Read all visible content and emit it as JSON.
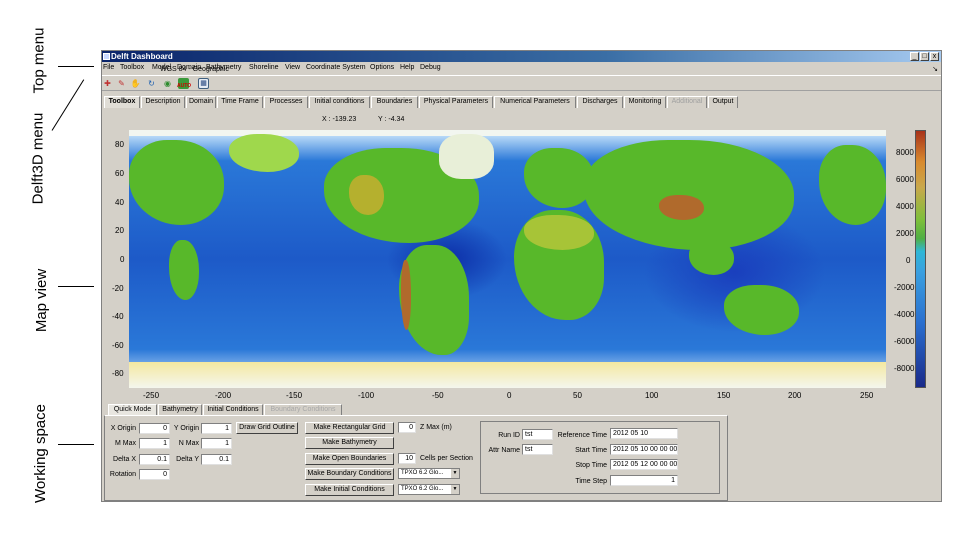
{
  "annotations": {
    "top_menu": "Top menu",
    "delft3d_menu": "Delft3D menu",
    "map_view": "Map view",
    "working_space": "Working space"
  },
  "window": {
    "title": "Delft Dashboard",
    "controls": [
      "_",
      "□",
      "x"
    ]
  },
  "menubar": [
    "File",
    "Toolbox",
    "Model",
    "Domain",
    "Bathymetry",
    "Shoreline",
    "View",
    "Coordinate System",
    "Options",
    "Help",
    "Debug"
  ],
  "toolbar": {
    "icons": [
      "zoom-in-icon",
      "zoom-out-icon",
      "pan-hand-icon",
      "refresh-icon",
      "globe-icon",
      "auto-icon",
      "chart-icon"
    ],
    "auto_label": "AUTO"
  },
  "tabs": [
    {
      "label": "Toolbox",
      "active": true
    },
    {
      "label": "Description"
    },
    {
      "label": "Domain"
    },
    {
      "label": "Time Frame"
    },
    {
      "label": "Processes"
    },
    {
      "label": "Initial conditions"
    },
    {
      "label": "Boundaries"
    },
    {
      "label": "Physical Parameters"
    },
    {
      "label": "Numerical Parameters"
    },
    {
      "label": "Discharges"
    },
    {
      "label": "Monitoring"
    },
    {
      "label": "Additional",
      "disabled": true
    },
    {
      "label": "Output"
    }
  ],
  "map": {
    "coord_system": "WGS 84 - Geographic",
    "x_readout": "X : -139.23",
    "y_readout": "Y : -4.34",
    "y_ticks": [
      "80",
      "60",
      "40",
      "20",
      "0",
      "-20",
      "-40",
      "-60",
      "-80"
    ],
    "x_ticks": [
      "-250",
      "-200",
      "-150",
      "-100",
      "-50",
      "0",
      "50",
      "100",
      "150",
      "200",
      "250"
    ],
    "colorbar_ticks": [
      "8000",
      "6000",
      "4000",
      "2000",
      "0",
      "-2000",
      "-4000",
      "-6000",
      "-8000"
    ]
  },
  "panel_tabs": [
    {
      "label": "Quick Mode",
      "active": true
    },
    {
      "label": "Bathymetry"
    },
    {
      "label": "Initial Conditions"
    },
    {
      "label": "Boundary Conditions",
      "disabled": true
    }
  ],
  "quick_mode": {
    "x_origin_label": "X Origin",
    "x_origin": "0",
    "y_origin_label": "Y Origin",
    "y_origin": "1",
    "m_max_label": "M Max",
    "m_max": "1",
    "n_max_label": "N Max",
    "n_max": "1",
    "delta_x_label": "Delta X",
    "delta_x": "0.1",
    "delta_y_label": "Delta Y",
    "delta_y": "0.1",
    "rotation_label": "Rotation",
    "rotation": "0",
    "draw_grid_outline": "Draw Grid Outline",
    "make_rect_grid": "Make Rectangular Grid",
    "make_bathymetry": "Make Bathymetry",
    "make_open_boundaries": "Make Open Boundaries",
    "make_boundary_conditions": "Make Boundary Conditions",
    "make_initial_conditions": "Make Initial Conditions",
    "z_max": "0",
    "z_max_label": "Z Max (m)",
    "cells_per_section": "10",
    "cells_per_section_label": "Cells per Section",
    "tide_model_1": "TPXO 6.2 Glo...",
    "tide_model_2": "TPXO 6.2 Glo..."
  },
  "run": {
    "run_id_label": "Run ID",
    "run_id": "tst",
    "attr_name_label": "Attr Name",
    "attr_name": "tst",
    "reference_time_label": "Reference Time",
    "reference_time": "2012 05 10",
    "start_time_label": "Start Time",
    "start_time": "2012 05 10 00 00 00",
    "stop_time_label": "Stop Time",
    "stop_time": "2012 05 12 00 00 00",
    "time_step_label": "Time Step",
    "time_step": "1"
  }
}
